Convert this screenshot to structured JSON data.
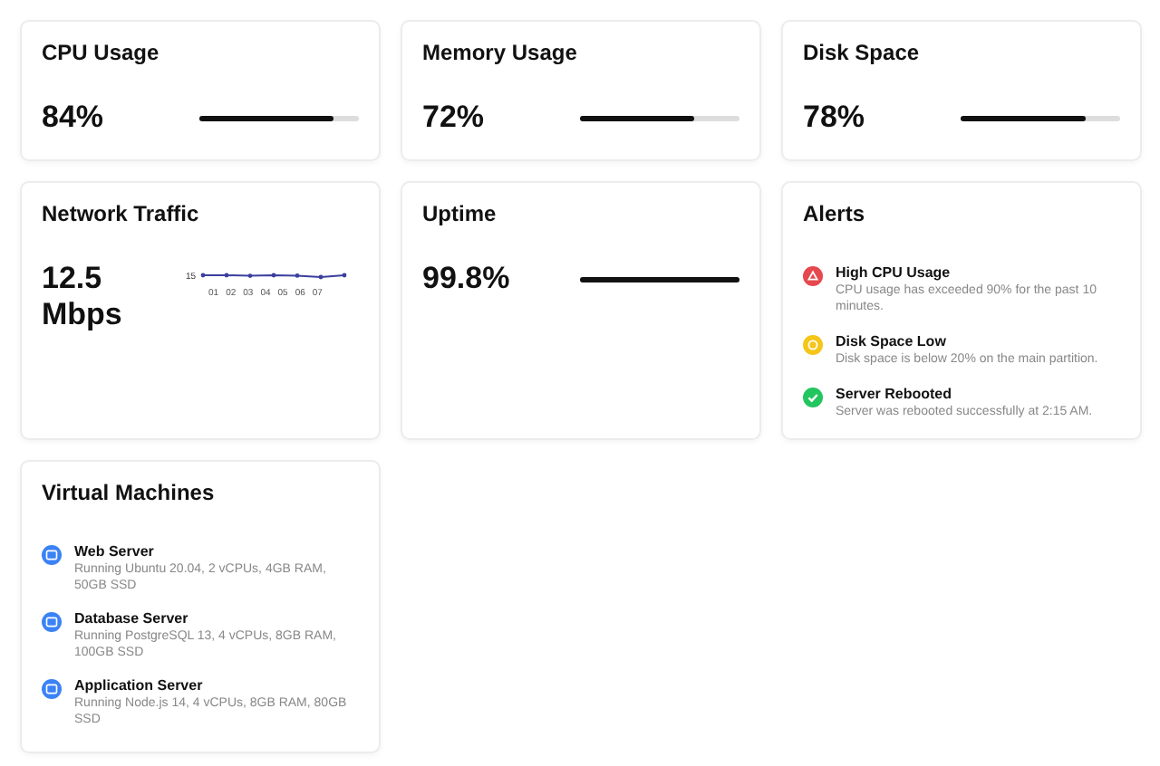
{
  "metrics": [
    {
      "title": "CPU Usage",
      "value": "84%",
      "level": 0.84
    },
    {
      "title": "Memory Usage",
      "value": "72%",
      "level": 0.72
    },
    {
      "title": "Disk Space",
      "value": "78%",
      "level": 0.78
    }
  ],
  "network": {
    "title": "Network Traffic",
    "value": "12.5 Mbps",
    "y_tick": "15",
    "x_labels": [
      "01",
      "02",
      "03",
      "04",
      "05",
      "06",
      "07"
    ]
  },
  "uptime": {
    "title": "Uptime",
    "value": "99.8%",
    "level": 0.998
  },
  "alerts": {
    "title": "Alerts",
    "items": [
      {
        "kind": "error",
        "title": "High CPU Usage",
        "text": "CPU usage has exceeded 90% for the past 10 minutes."
      },
      {
        "kind": "warning",
        "title": "Disk Space Low",
        "text": "Disk space is below 20% on the main partition."
      },
      {
        "kind": "success",
        "title": "Server Rebooted",
        "text": "Server was rebooted successfully at 2:15 AM."
      }
    ]
  },
  "vms": {
    "title": "Virtual Machines",
    "items": [
      {
        "name": "Web Server",
        "text": "Running Ubuntu 20.04, 2 vCPUs, 4GB RAM, 50GB SSD"
      },
      {
        "name": "Database Server",
        "text": "Running PostgreSQL 13, 4 vCPUs, 8GB RAM, 100GB SSD"
      },
      {
        "name": "Application Server",
        "text": "Running Node.js 14, 4 vCPUs, 8GB RAM, 80GB SSD"
      }
    ]
  }
}
